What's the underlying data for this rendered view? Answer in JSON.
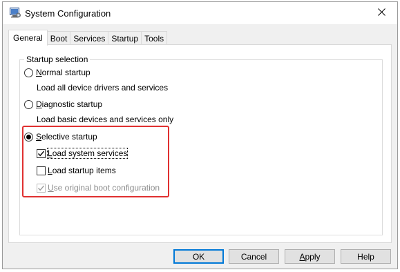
{
  "window": {
    "title": "System Configuration",
    "icon": "msconfig-icon",
    "close_glyph": "✕"
  },
  "tabs": [
    {
      "label": "General",
      "active": true
    },
    {
      "label": "Boot",
      "active": false
    },
    {
      "label": "Services",
      "active": false
    },
    {
      "label": "Startup",
      "active": false
    },
    {
      "label": "Tools",
      "active": false
    }
  ],
  "startup_selection": {
    "title": "Startup selection",
    "normal": {
      "mnemonic": "N",
      "label_rest": "ormal startup",
      "description": "Load all device drivers and services",
      "checked": false
    },
    "diagnostic": {
      "mnemonic": "D",
      "label_rest": "iagnostic startup",
      "description": "Load basic devices and services only",
      "checked": false
    },
    "selective": {
      "mnemonic": "S",
      "label_rest": "elective startup",
      "checked": true,
      "options": {
        "load_system_services": {
          "mnemonic": "L",
          "label_rest": "oad system services",
          "checked": true,
          "disabled": false
        },
        "load_startup_items": {
          "mnemonic": "L",
          "label_rest": "oad startup items",
          "checked": false,
          "disabled": false
        },
        "use_original_boot": {
          "mnemonic": "U",
          "label_rest": "se original boot configuration",
          "checked": true,
          "disabled": true
        }
      }
    }
  },
  "buttons": {
    "ok": "OK",
    "cancel": "Cancel",
    "apply_mnemonic": "A",
    "apply_rest": "pply",
    "help": "Help"
  },
  "colors": {
    "highlight": "#e03030",
    "default_button_border": "#0078d7"
  }
}
